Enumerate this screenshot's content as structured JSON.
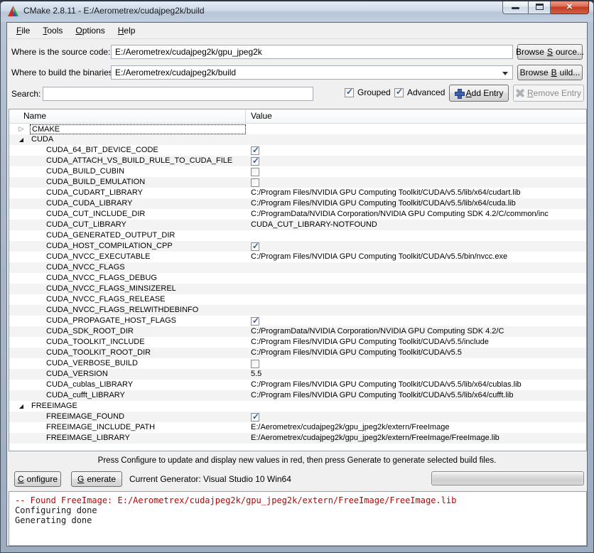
{
  "window": {
    "title": "CMake 2.8.11 - E:/Aerometrex/cudajpeg2k/build"
  },
  "menu": {
    "items": [
      {
        "label": "File",
        "accel": 0
      },
      {
        "label": "Tools",
        "accel": 0
      },
      {
        "label": "Options",
        "accel": 0
      },
      {
        "label": "Help",
        "accel": 0
      }
    ]
  },
  "paths": {
    "source_label": "Where is the source code:",
    "source_value": "E:/Aerometrex/cudajpeg2k/gpu_jpeg2k",
    "browse_source": {
      "label": "Browse Source...",
      "accel": 7
    },
    "build_label": "Where to build the binaries:",
    "build_value": "E:/Aerometrex/cudajpeg2k/build",
    "browse_build": {
      "label": "Browse Build...",
      "accel": 7
    }
  },
  "search": {
    "label": "Search:",
    "value": "",
    "placeholder": ""
  },
  "toolbar": {
    "grouped_label": "Grouped",
    "grouped_checked": true,
    "advanced_label": "Advanced",
    "advanced_checked": true,
    "add_entry": {
      "label": "Add Entry",
      "accel": 0
    },
    "remove_entry": {
      "label": "Remove Entry",
      "accel": 0
    },
    "remove_entry_enabled": false
  },
  "cache_table": {
    "columns": [
      "Name",
      "Value"
    ],
    "groups": [
      {
        "name": "CMAKE",
        "expanded": false,
        "focused": true,
        "entries": []
      },
      {
        "name": "CUDA",
        "expanded": true,
        "focused": false,
        "entries": [
          {
            "name": "CUDA_64_BIT_DEVICE_CODE",
            "type": "bool",
            "checked": true
          },
          {
            "name": "CUDA_ATTACH_VS_BUILD_RULE_TO_CUDA_FILE",
            "type": "bool",
            "checked": true
          },
          {
            "name": "CUDA_BUILD_CUBIN",
            "type": "bool",
            "checked": false
          },
          {
            "name": "CUDA_BUILD_EMULATION",
            "type": "bool",
            "checked": false
          },
          {
            "name": "CUDA_CUDART_LIBRARY",
            "type": "text",
            "value": "C:/Program Files/NVIDIA GPU Computing Toolkit/CUDA/v5.5/lib/x64/cudart.lib"
          },
          {
            "name": "CUDA_CUDA_LIBRARY",
            "type": "text",
            "value": "C:/Program Files/NVIDIA GPU Computing Toolkit/CUDA/v5.5/lib/x64/cuda.lib"
          },
          {
            "name": "CUDA_CUT_INCLUDE_DIR",
            "type": "text",
            "value": "C:/ProgramData/NVIDIA Corporation/NVIDIA GPU Computing SDK 4.2/C/common/inc"
          },
          {
            "name": "CUDA_CUT_LIBRARY",
            "type": "text",
            "value": "CUDA_CUT_LIBRARY-NOTFOUND"
          },
          {
            "name": "CUDA_GENERATED_OUTPUT_DIR",
            "type": "text",
            "value": ""
          },
          {
            "name": "CUDA_HOST_COMPILATION_CPP",
            "type": "bool",
            "checked": true
          },
          {
            "name": "CUDA_NVCC_EXECUTABLE",
            "type": "text",
            "value": "C:/Program Files/NVIDIA GPU Computing Toolkit/CUDA/v5.5/bin/nvcc.exe"
          },
          {
            "name": "CUDA_NVCC_FLAGS",
            "type": "text",
            "value": ""
          },
          {
            "name": "CUDA_NVCC_FLAGS_DEBUG",
            "type": "text",
            "value": ""
          },
          {
            "name": "CUDA_NVCC_FLAGS_MINSIZEREL",
            "type": "text",
            "value": ""
          },
          {
            "name": "CUDA_NVCC_FLAGS_RELEASE",
            "type": "text",
            "value": ""
          },
          {
            "name": "CUDA_NVCC_FLAGS_RELWITHDEBINFO",
            "type": "text",
            "value": ""
          },
          {
            "name": "CUDA_PROPAGATE_HOST_FLAGS",
            "type": "bool",
            "checked": true
          },
          {
            "name": "CUDA_SDK_ROOT_DIR",
            "type": "text",
            "value": "C:/ProgramData/NVIDIA Corporation/NVIDIA GPU Computing SDK 4.2/C"
          },
          {
            "name": "CUDA_TOOLKIT_INCLUDE",
            "type": "text",
            "value": "C:/Program Files/NVIDIA GPU Computing Toolkit/CUDA/v5.5/include"
          },
          {
            "name": "CUDA_TOOLKIT_ROOT_DIR",
            "type": "text",
            "value": "C:/Program Files/NVIDIA GPU Computing Toolkit/CUDA/v5.5"
          },
          {
            "name": "CUDA_VERBOSE_BUILD",
            "type": "bool",
            "checked": false
          },
          {
            "name": "CUDA_VERSION",
            "type": "text",
            "value": "5.5"
          },
          {
            "name": "CUDA_cublas_LIBRARY",
            "type": "text",
            "value": "C:/Program Files/NVIDIA GPU Computing Toolkit/CUDA/v5.5/lib/x64/cublas.lib"
          },
          {
            "name": "CUDA_cufft_LIBRARY",
            "type": "text",
            "value": "C:/Program Files/NVIDIA GPU Computing Toolkit/CUDA/v5.5/lib/x64/cufft.lib"
          }
        ]
      },
      {
        "name": "FREEIMAGE",
        "expanded": true,
        "focused": false,
        "entries": [
          {
            "name": "FREEIMAGE_FOUND",
            "type": "bool",
            "checked": true
          },
          {
            "name": "FREEIMAGE_INCLUDE_PATH",
            "type": "text",
            "value": "E:/Aerometrex/cudajpeg2k/gpu_jpeg2k/extern/FreeImage"
          },
          {
            "name": "FREEIMAGE_LIBRARY",
            "type": "text",
            "value": "E:/Aerometrex/cudajpeg2k/gpu_jpeg2k/extern/FreeImage/FreeImage.lib"
          }
        ]
      }
    ]
  },
  "hint": "Press Configure to update and display new values in red, then press Generate to generate selected build files.",
  "actions": {
    "configure": {
      "label": "Configure",
      "accel": 0
    },
    "generate": {
      "label": "Generate",
      "accel": 0
    },
    "generator_text": "Current Generator: Visual Studio 10 Win64",
    "progress_percent": 0
  },
  "output": {
    "lines": [
      {
        "text": "-- Found FreeImage: E:/Aerometrex/cudajpeg2k/gpu_jpeg2k/extern/FreeImage/FreeImage.lib",
        "color": "#c00000"
      },
      {
        "text": "Configuring done",
        "color": "#1a1a1a"
      },
      {
        "text": "Generating done",
        "color": "#1a1a1a"
      }
    ]
  },
  "icons": {
    "expander_collapsed": "▷",
    "expander_expanded": "◢",
    "close_glyph": "×"
  },
  "colors": {
    "output_red": "#c00000",
    "check_blue": "#31609f",
    "add_icon_blue": "#3c63ae",
    "close_button_red": "#c23c22"
  }
}
